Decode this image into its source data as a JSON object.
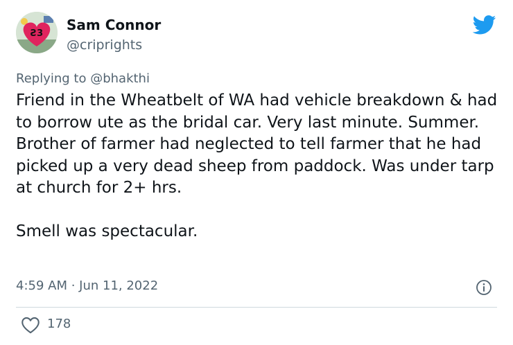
{
  "author": {
    "display_name": "Sam Connor",
    "handle": "@criprights",
    "avatar_icon": "avatar-photo",
    "avatar_badge_text": "Ƨ3"
  },
  "reply": {
    "prefix": "Replying to ",
    "mention": "@bhakthi"
  },
  "tweet": {
    "text": "Friend in the Wheatbelt of WA had vehicle breakdown & had to borrow ute as the bridal car. Very last minute. Summer. Brother of farmer had neglected to tell farmer that he had picked up a very dead sheep from paddock. Was under tarp at church for 2+ hrs.\n\nSmell was spectacular."
  },
  "meta": {
    "timestamp": "4:59 AM · Jun 11, 2022"
  },
  "actions": {
    "likes": "178"
  },
  "icons": {
    "brand": "twitter-bird-icon",
    "info": "info-icon",
    "like": "heart-icon"
  },
  "colors": {
    "brand_blue": "#1d9bf0",
    "secondary_text": "#536471",
    "divider": "#cfd9de"
  }
}
